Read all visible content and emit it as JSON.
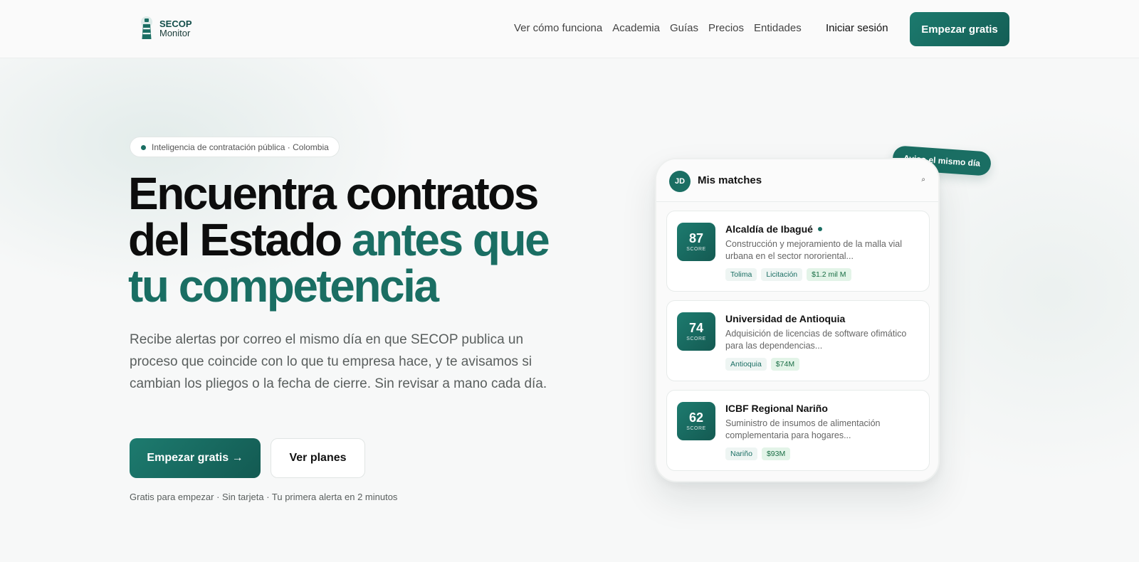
{
  "brand": {
    "line1": "SECOP",
    "line2": "Monitor"
  },
  "nav": {
    "links": [
      "Ver cómo funciona",
      "Academia",
      "Guías",
      "Precios",
      "Entidades"
    ],
    "login": "Iniciar sesión",
    "cta": "Empezar gratis"
  },
  "hero": {
    "pill": "Inteligencia de contratación pública · Colombia",
    "headline_a": "Encuentra contratos del Estado ",
    "headline_accent": "antes que tu competencia",
    "lead": "Recibe alertas por correo el mismo día en que SECOP publica un proceso que coincide con lo que tu empresa hace, y te avisamos si cambian los pliegos o la fecha de cierre. Sin revisar a mano cada día.",
    "primary_cta": "Empezar gratis →",
    "secondary_cta": "Ver planes",
    "fineprint": "Gratis para empezar · Sin tarjeta · Tu primera alerta en 2 minutos"
  },
  "phone": {
    "avatar": "JD",
    "title": "Mis matches",
    "search_icon": "⌕",
    "floating_badge": "Aviso el mismo día",
    "score_label": "SCORE",
    "matches": [
      {
        "score": "87",
        "entity": "Alcaldía de Ibagué",
        "new": true,
        "desc": "Construcción y mejoramiento de la malla vial urbana en el sector nororiental...",
        "tags": [
          "Tolima",
          "Licitación"
        ],
        "amount": "$1.2 mil M"
      },
      {
        "score": "74",
        "entity": "Universidad de Antioquia",
        "new": false,
        "desc": "Adquisición de licencias de software ofimático para las dependencias...",
        "tags": [
          "Antioquia"
        ],
        "amount": "$74M"
      },
      {
        "score": "62",
        "entity": "ICBF Regional Nariño",
        "new": false,
        "desc": "Suministro de insumos de alimentación complementaria para hogares...",
        "tags": [
          "Nariño"
        ],
        "amount": "$93M"
      }
    ]
  },
  "colors": {
    "accent": "#1a6e63",
    "accent_dark": "#134e4a",
    "text": "#0d0d0d",
    "muted": "#5a5f5e"
  }
}
